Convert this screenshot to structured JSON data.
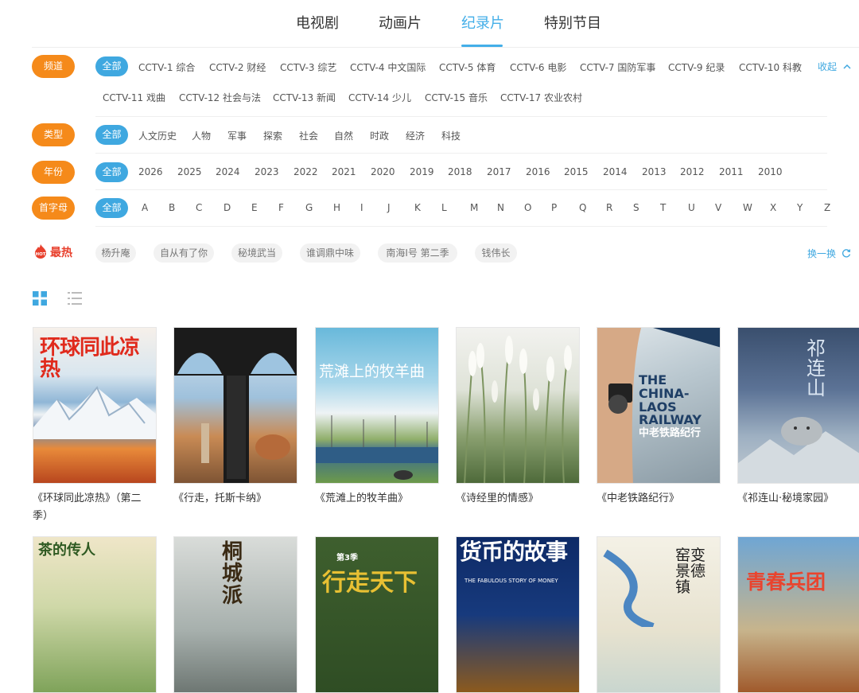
{
  "tabs": [
    {
      "label": "电视剧"
    },
    {
      "label": "动画片"
    },
    {
      "label": "纪录片",
      "active": true
    },
    {
      "label": "特别节目"
    }
  ],
  "filters": {
    "channel": {
      "label": "频道",
      "all": "全部",
      "row1": [
        "CCTV-1 综合",
        "CCTV-2 财经",
        "CCTV-3 综艺",
        "CCTV-4 中文国际",
        "CCTV-5 体育",
        "CCTV-6 电影",
        "CCTV-7 国防军事",
        "CCTV-9 纪录",
        "CCTV-10 科教"
      ],
      "row2": [
        "CCTV-11 戏曲",
        "CCTV-12 社会与法",
        "CCTV-13 新闻",
        "CCTV-14 少儿",
        "CCTV-15 音乐",
        "CCTV-17 农业农村"
      ],
      "collapse": "收起"
    },
    "type": {
      "label": "类型",
      "all": "全部",
      "options": [
        "人文历史",
        "人物",
        "军事",
        "探索",
        "社会",
        "自然",
        "时政",
        "经济",
        "科技"
      ]
    },
    "year": {
      "label": "年份",
      "all": "全部",
      "options": [
        "2026",
        "2025",
        "2024",
        "2023",
        "2022",
        "2021",
        "2020",
        "2019",
        "2018",
        "2017",
        "2016",
        "2015",
        "2014",
        "2013",
        "2012",
        "2011",
        "2010"
      ]
    },
    "initial": {
      "label": "首字母",
      "all": "全部",
      "options": [
        "A",
        "B",
        "C",
        "D",
        "E",
        "F",
        "G",
        "H",
        "I",
        "J",
        "K",
        "L",
        "M",
        "N",
        "O",
        "P",
        "Q",
        "R",
        "S",
        "T",
        "U",
        "V",
        "W",
        "X",
        "Y",
        "Z"
      ]
    }
  },
  "hot": {
    "icon_text": "HOT",
    "label": "最热",
    "tags": [
      "杨升庵",
      "自从有了你",
      "秘境武当",
      "谁调鼎中味",
      "南海Ⅰ号 第二季",
      "钱伟长"
    ],
    "refresh": "换一换"
  },
  "colors": {
    "accent": "#3fa8e0",
    "badge": "#f58a1a",
    "hot": "#e8402d"
  },
  "cards": [
    {
      "caption": "《环球同此凉热》（第二季）",
      "poster_title": "环球同此凉热",
      "icon": "glacier-city-poster"
    },
    {
      "caption": "《行走，托斯卡纳》",
      "poster_title": "",
      "icon": "florence-arch-poster"
    },
    {
      "caption": "《荒滩上的牧羊曲》",
      "poster_title": "荒滩上的牧羊曲",
      "icon": "solar-farm-poster"
    },
    {
      "caption": "《诗经里的情感》",
      "poster_title": "",
      "icon": "reed-grass-poster"
    },
    {
      "caption": "《中老铁路纪行》",
      "poster_title": "THE CHINA-LAOS RAILWAY",
      "poster_sub": "中老铁路纪行",
      "icon": "camera-railway-poster"
    },
    {
      "caption": "《祁连山·秘境家园》",
      "poster_title": "祁连山",
      "icon": "snow-leopard-poster"
    },
    {
      "caption": "",
      "poster_title": "茶的传人",
      "icon": "tea-terrace-poster"
    },
    {
      "caption": "",
      "poster_title": "桐城派",
      "icon": "ink-brush-poster"
    },
    {
      "caption": "",
      "poster_title": "行走天下",
      "poster_sub": "第3季",
      "icon": "calligraphy-poster"
    },
    {
      "caption": "",
      "poster_title": "货币的故事",
      "poster_sub": "THE FABULOUS STORY OF MONEY",
      "icon": "money-crowd-poster"
    },
    {
      "caption": "",
      "poster_title": "窑变景德镇",
      "icon": "river-city-poster"
    },
    {
      "caption": "",
      "poster_title": "青春兵团",
      "icon": "youth-corps-poster"
    }
  ]
}
